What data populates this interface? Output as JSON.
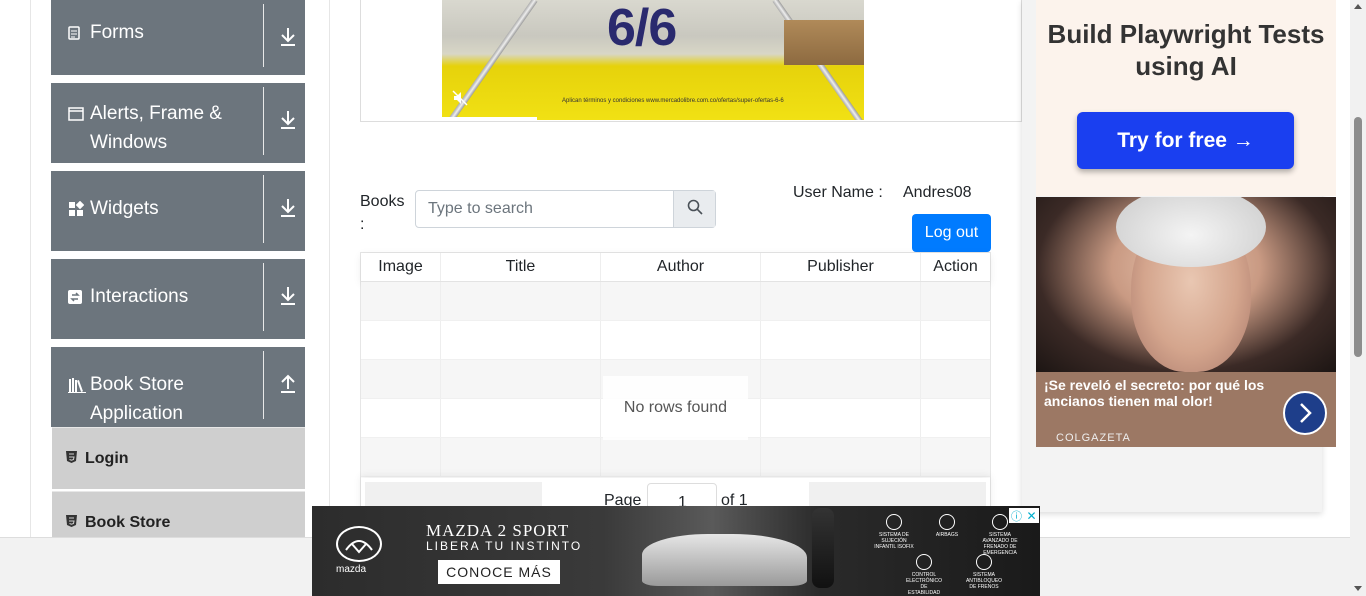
{
  "sidebar": {
    "groups": [
      {
        "label": "Forms",
        "icon": "file-icon"
      },
      {
        "label": "Alerts, Frame & Windows",
        "icon": "window-icon"
      },
      {
        "label": "Widgets",
        "icon": "widgets-icon"
      },
      {
        "label": "Interactions",
        "icon": "interactions-icon"
      },
      {
        "label": "Book Store Application",
        "icon": "books-icon"
      }
    ],
    "items": [
      {
        "label": "Login"
      },
      {
        "label": "Book Store"
      }
    ]
  },
  "video": {
    "big_text": "6/6",
    "fine_print": "Aplican términos y condiciones www.mercadolibre.com.co/ofertas/super-ofertas-6-6"
  },
  "books": {
    "label": "Books :",
    "search_placeholder": "Type to search"
  },
  "user": {
    "label": "User Name :",
    "value": "Andres08",
    "logout_label": "Log out"
  },
  "table": {
    "headers": [
      "Image",
      "Title",
      "Author",
      "Publisher",
      "Action"
    ],
    "empty_text": "No rows found",
    "pagination": {
      "page_label": "Page",
      "page_value": "1",
      "of_label": "of 1"
    }
  },
  "right_ad": {
    "headline": "Build Playwright Tests using AI",
    "cta": "Try for free →",
    "caption": "¡Se reveló el secreto: por qué los ancianos tienen mal olor!",
    "source": "COLGAZETA"
  },
  "bottom_ad": {
    "brand": "mazda",
    "headline": "MAZDA 2 SPORT",
    "subline": "LIBERA TU INSTINTO",
    "cta": "CONOCE MÁS",
    "features": [
      "SISTEMA DE SUJECIÓN INFANTIL ISOFIX",
      "AIRBAGS",
      "SISTEMA AVANZADO DE FRENADO DE EMERGENCIA",
      "CONTROL ELECTRÓNICO DE ESTABILIDAD",
      "SISTEMA ANTIBLOQUEO DE FRENOS"
    ],
    "info_icon": "ⓘ",
    "close_icon": "✕"
  }
}
